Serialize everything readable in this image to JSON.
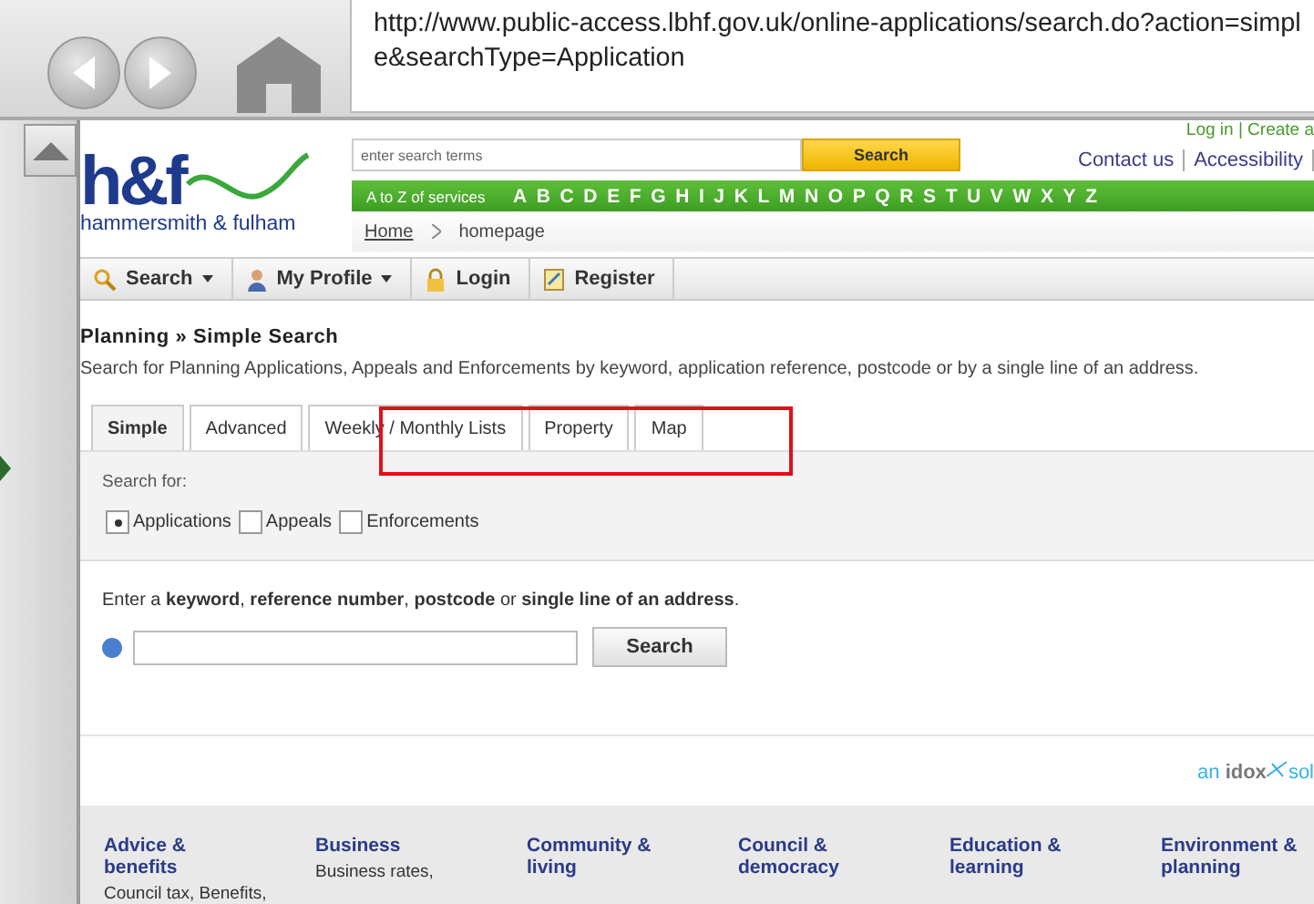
{
  "browser": {
    "url": "http://www.public-access.lbhf.gov.uk/online-applications/search.do?action=simple&searchType=Application"
  },
  "header": {
    "logo_mark": "h&f",
    "logo_name": "hammersmith & fulham",
    "search_placeholder": "enter search terms",
    "search_button": "Search",
    "top_links": "Log in | Create a",
    "links": [
      "Contact us",
      "Accessibility"
    ],
    "az_label": "A to Z of services",
    "letters": [
      "A",
      "B",
      "C",
      "D",
      "E",
      "F",
      "G",
      "H",
      "I",
      "J",
      "K",
      "L",
      "M",
      "N",
      "O",
      "P",
      "Q",
      "R",
      "S",
      "T",
      "U",
      "V",
      "W",
      "X",
      "Y",
      "Z"
    ],
    "breadcrumb": [
      "Home",
      "homepage"
    ]
  },
  "menu": [
    {
      "label": "Search",
      "kind": "search",
      "dropdown": true
    },
    {
      "label": "My Profile",
      "kind": "profile",
      "dropdown": true
    },
    {
      "label": "Login",
      "kind": "lock",
      "dropdown": false
    },
    {
      "label": "Register",
      "kind": "register",
      "dropdown": false
    }
  ],
  "heading": "Planning » Simple Search",
  "description": "Search for Planning Applications, Appeals and Enforcements by keyword, application reference, postcode or by a single line of an address.",
  "tabs": [
    {
      "label": "Simple",
      "selected": true
    },
    {
      "label": "Advanced",
      "selected": false
    },
    {
      "label": "Weekly / Monthly Lists",
      "selected": false
    },
    {
      "label": "Property",
      "selected": false
    },
    {
      "label": "Map",
      "selected": false
    }
  ],
  "search_for": {
    "label": "Search for:",
    "options": [
      {
        "label": "Applications",
        "selected": true
      },
      {
        "label": "Appeals",
        "selected": false
      },
      {
        "label": "Enforcements",
        "selected": false
      }
    ]
  },
  "prompt": "Enter a **keyword**, **reference number**, **postcode** or **single line of an address**.",
  "search_button": "Search",
  "idox": {
    "prefix": "an",
    "name": "idox",
    "suffix": "sol"
  },
  "footer": [
    {
      "title": "Advice & benefits",
      "text": "Council tax, Benefits,"
    },
    {
      "title": "Business",
      "text": "Business rates,"
    },
    {
      "title": "Community & living"
    },
    {
      "title": "Council & democracy"
    },
    {
      "title": "Education & learning"
    },
    {
      "title": "Environment & planning"
    }
  ]
}
